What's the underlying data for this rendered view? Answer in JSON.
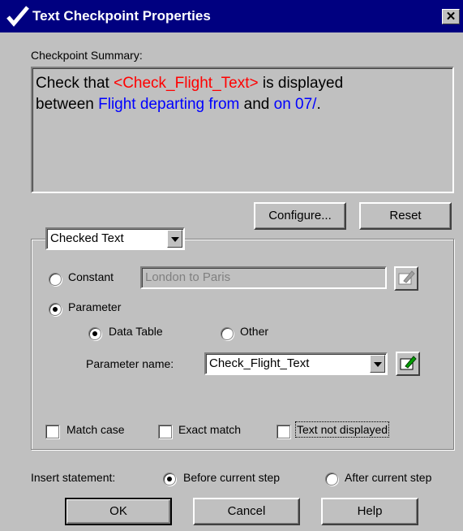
{
  "window": {
    "title": "Text Checkpoint Properties",
    "close_label": "✕"
  },
  "summary": {
    "label": "Checkpoint Summary:",
    "line1_prefix": "Check that ",
    "line1_param": "<Check_Flight_Text>",
    "line1_suffix": " is  displayed",
    "line2_prefix": "between ",
    "line2_before": "Flight departing from",
    "line2_mid": "  and ",
    "line2_after": "on 07/",
    "line2_end": "."
  },
  "buttons": {
    "configure": "Configure...",
    "reset": "Reset",
    "ok": "OK",
    "cancel": "Cancel",
    "help": "Help"
  },
  "group": {
    "selected": "Checked Text"
  },
  "constant": {
    "label": "Constant",
    "value": "London to Paris",
    "selected": false
  },
  "parameter": {
    "label": "Parameter",
    "selected": true,
    "data_table": {
      "label": "Data Table",
      "selected": true
    },
    "other": {
      "label": "Other",
      "selected": false
    },
    "name_label": "Parameter name:",
    "name_value": "Check_Flight_Text"
  },
  "options": {
    "match_case": "Match case",
    "exact_match": "Exact match",
    "text_not_displayed": "Text not displayed"
  },
  "insert": {
    "label": "Insert statement:",
    "before": "Before current step",
    "after": "After current step",
    "selected": "before"
  }
}
